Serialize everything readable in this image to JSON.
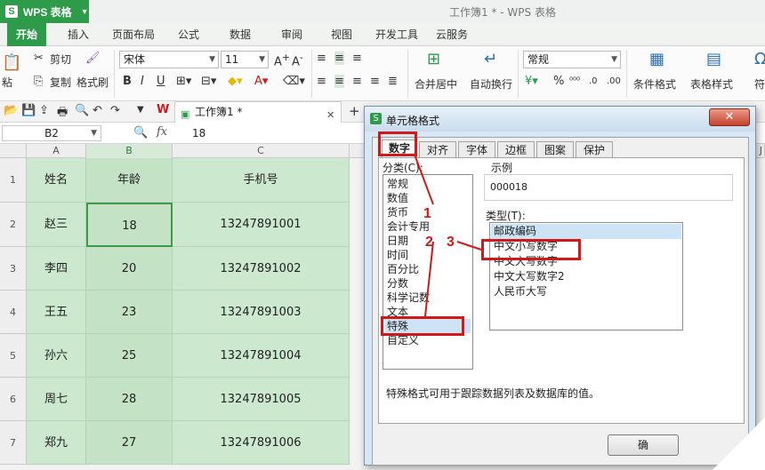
{
  "app": {
    "name": "WPS 表格",
    "window_title": "工作簿1 * - WPS 表格"
  },
  "ribbon_tabs": [
    "开始",
    "插入",
    "页面布局",
    "公式",
    "数据",
    "审阅",
    "视图",
    "开发工具",
    "云服务"
  ],
  "ribbon": {
    "cut": "剪切",
    "copy": "复制",
    "format_painter": "格式刷",
    "paste": "粘",
    "font_name": "宋体",
    "font_size": "11",
    "merge_center": "合并居中",
    "wrap_text": "自动换行",
    "number_format": "常规",
    "conditional_format": "条件格式",
    "table_style": "表格样式",
    "symbol": "符"
  },
  "document_tab": "工作簿1 *",
  "formula_bar": {
    "name_box": "B2",
    "fx": "fx",
    "value": "18"
  },
  "columns": [
    "A",
    "B",
    "C",
    "J"
  ],
  "rows": [
    {
      "num": "1",
      "a": "姓名",
      "b": "年龄",
      "c": "手机号"
    },
    {
      "num": "2",
      "a": "赵三",
      "b": "18",
      "c": "13247891001"
    },
    {
      "num": "3",
      "a": "李四",
      "b": "20",
      "c": "13247891002"
    },
    {
      "num": "4",
      "a": "王五",
      "b": "23",
      "c": "13247891003"
    },
    {
      "num": "5",
      "a": "孙六",
      "b": "25",
      "c": "13247891004"
    },
    {
      "num": "6",
      "a": "周七",
      "b": "28",
      "c": "13247891005"
    },
    {
      "num": "7",
      "a": "郑九",
      "b": "27",
      "c": "13247891006"
    }
  ],
  "dialog": {
    "title": "单元格格式",
    "close": "✕",
    "tabs": [
      "数字",
      "对齐",
      "字体",
      "边框",
      "图案",
      "保护"
    ],
    "category_label": "分类(C):",
    "categories": [
      "常规",
      "数值",
      "货币",
      "会计专用",
      "日期",
      "时间",
      "百分比",
      "分数",
      "科学记数",
      "文本",
      "特殊",
      "自定义"
    ],
    "selected_category": "特殊",
    "sample_label": "示例",
    "sample_value": "000018",
    "type_label": "类型(T):",
    "types": [
      "邮政编码",
      "中文小写数字",
      "中文大写数字",
      "中文大写数字2",
      "人民币大写"
    ],
    "selected_type": "邮政编码",
    "description": "特殊格式可用于跟踪数据列表及数据库的值。",
    "ok": "确"
  },
  "annotations": [
    "1",
    "2",
    "3"
  ],
  "colors": {
    "accent": "#2d9b4a",
    "annotation": "#d0191a",
    "selection": "#cce8cf"
  }
}
